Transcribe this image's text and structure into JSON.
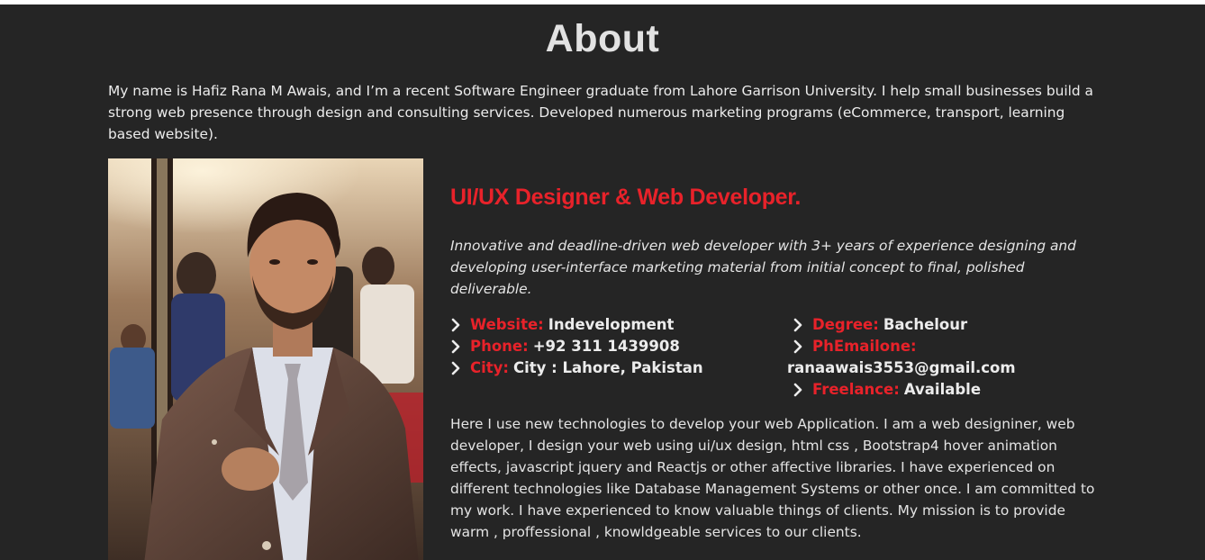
{
  "about": {
    "title": "About",
    "intro": "My name is Hafiz Rana M Awais, and I’m a recent Software Engineer graduate from Lahore Garrison University. I help small businesses build a strong web presence through design and consulting services. Developed numerous marketing programs (eCommerce, transport, learning based website).",
    "photo_icon": "profile-photo",
    "role": "UI/UX Designer & Web Developer.",
    "summary": "Innovative and deadline-driven web developer with 3+ years of experience designing and developing user-interface marketing material from initial concept to final, polished deliverable.",
    "facts_left": [
      {
        "label": "Website:",
        "value": "Indevelopment"
      },
      {
        "label": "Phone:",
        "value": "+92 311 1439908"
      },
      {
        "label": "City:",
        "value": "City : Lahore, Pakistan"
      }
    ],
    "facts_right": [
      {
        "label": "Degree:",
        "value": "Bachelour"
      },
      {
        "label": "PhEmailone:",
        "value": "ranaawais3553@gmail.com"
      },
      {
        "label": "Freelance:",
        "value": "Available"
      }
    ],
    "description": "Here I use new technologies to develop your web Application. I am a web designiner, web developer, I design your web using ui/ux design, html css , Bootstrap4 hover animation effects, javascript jquery and Reactjs or other affective libraries. I have experienced on different technologies like Database Management Systems or other once. I am committed to my work. I have experienced to know valuable things of clients. My mission is to provide warm , proffessional , knowldgeable services to our clients.",
    "colors": {
      "accent": "#e8222a",
      "background": "#252525",
      "text": "#e4e4e4"
    }
  }
}
